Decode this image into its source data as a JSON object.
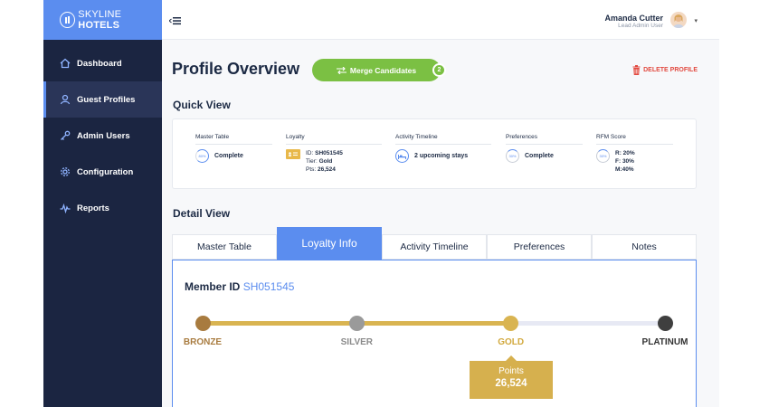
{
  "brand": {
    "name_light": "SKYLINE",
    "name_bold": "HOTELS"
  },
  "sidebar": {
    "items": [
      {
        "label": "Dashboard",
        "icon": "home-icon"
      },
      {
        "label": "Guest Profiles",
        "icon": "user-icon",
        "active": true
      },
      {
        "label": "Admin Users",
        "icon": "key-icon"
      },
      {
        "label": "Configuration",
        "icon": "gear-icon"
      },
      {
        "label": "Reports",
        "icon": "pulse-icon"
      }
    ]
  },
  "user": {
    "name": "Amanda Cutter",
    "role": "Lead Admin User"
  },
  "page": {
    "title": "Profile Overview",
    "merge_label": "Merge Candidates",
    "merge_count": "2",
    "delete_label": "DELETE PROFILE"
  },
  "quick_view": {
    "title": "Quick View",
    "master_table": {
      "title": "Master Table",
      "ring": "80%",
      "value": "Complete"
    },
    "loyalty": {
      "title": "Loyalty",
      "id_label": "ID:",
      "id": "SH051545",
      "tier_label": "Tier:",
      "tier": "Gold",
      "pts_label": "Pts:",
      "pts": "26,524"
    },
    "activity": {
      "title": "Activity Timeline",
      "value": "2 upcoming stays"
    },
    "preferences": {
      "title": "Preferences",
      "ring": "30%",
      "value": "Complete"
    },
    "rfm": {
      "title": "RFM Score",
      "ring": "30%",
      "r": "R: 20%",
      "f": "F: 30%",
      "m": "M:40%"
    }
  },
  "detail_view": {
    "title": "Detail View",
    "tabs": [
      "Master Table",
      "Loyalty Info",
      "Activity Timeline",
      "Preferences",
      "Notes"
    ],
    "active_tab": 1,
    "member_label": "Member ID",
    "member_id": "SH051545",
    "tiers": [
      {
        "name": "BRONZE",
        "color": "#a87b3f",
        "text_color": "#a87b3f"
      },
      {
        "name": "SILVER",
        "color": "#9a9a9a",
        "text_color": "#8a8a8a"
      },
      {
        "name": "GOLD",
        "color": "#d9b451",
        "text_color": "#d2a93e"
      },
      {
        "name": "PLATINUM",
        "color": "#3f3f3f",
        "text_color": "#333333"
      }
    ],
    "current_tier_index": 2,
    "points_label": "Points",
    "points_value": "26,524"
  },
  "colors": {
    "accent": "#5b8def",
    "sidebar": "#1b2541",
    "success": "#7bc043",
    "danger": "#e2493f",
    "gold": "#d6b04e"
  }
}
